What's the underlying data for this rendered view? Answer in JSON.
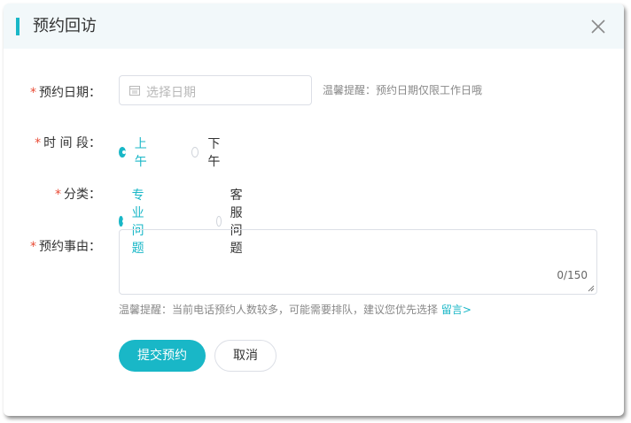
{
  "dialog": {
    "title": "预约回访",
    "close_icon": "close-icon"
  },
  "form": {
    "date": {
      "required_mark": "*",
      "label": "预约日期：",
      "placeholder": "选择日期",
      "icon": "calendar-icon",
      "hint": "温馨提醒：预约日期仅限工作日哦"
    },
    "period": {
      "required_mark": "*",
      "label": "时 间 段：",
      "options": [
        {
          "label": "上午",
          "selected": true
        },
        {
          "label": "下午",
          "selected": false
        }
      ]
    },
    "category": {
      "required_mark": "*",
      "label": "分类：",
      "options": [
        {
          "label": "专业问题",
          "selected": true
        },
        {
          "label": "客服问题",
          "selected": false
        }
      ]
    },
    "reason": {
      "required_mark": "*",
      "label": "预约事由：",
      "value": "",
      "counter": "0/150"
    },
    "note": {
      "text": "温馨提醒：当前电话预约人数较多，可能需要排队，建议您优先选择 ",
      "link": "留言>"
    }
  },
  "buttons": {
    "submit": "提交预约",
    "cancel": "取消"
  },
  "colors": {
    "accent": "#19b7c7",
    "required": "#e94b35",
    "header_bg": "#f2f8fa"
  }
}
